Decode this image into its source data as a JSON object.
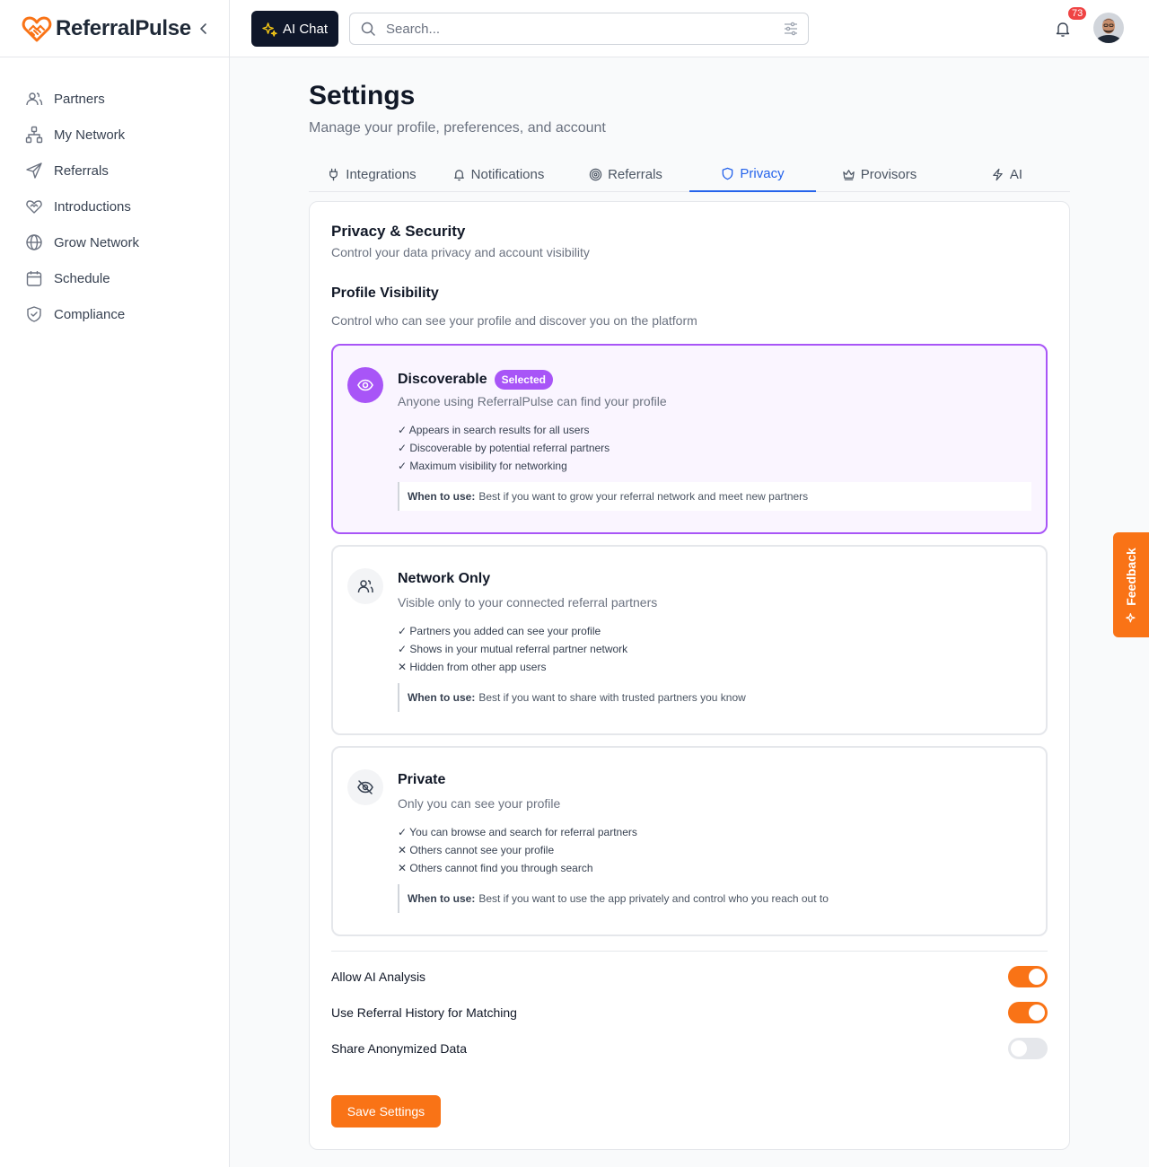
{
  "brand": {
    "name": "ReferralPulse",
    "color": "#f97316"
  },
  "sidebar": {
    "items": [
      {
        "label": "Partners",
        "icon": "users-icon"
      },
      {
        "label": "My Network",
        "icon": "network-icon"
      },
      {
        "label": "Referrals",
        "icon": "send-icon"
      },
      {
        "label": "Introductions",
        "icon": "handshake-icon"
      },
      {
        "label": "Grow Network",
        "icon": "globe-icon"
      },
      {
        "label": "Schedule",
        "icon": "calendar-icon"
      },
      {
        "label": "Compliance",
        "icon": "shield-check-icon"
      }
    ]
  },
  "header": {
    "ai_chat_label": "AI Chat",
    "search_placeholder": "Search...",
    "notification_count": "73"
  },
  "page": {
    "title": "Settings",
    "subtitle": "Manage your profile, preferences, and account"
  },
  "tabs": [
    {
      "label": "Integrations",
      "icon": "plug-icon"
    },
    {
      "label": "Notifications",
      "icon": "bell-icon"
    },
    {
      "label": "Referrals",
      "icon": "target-icon"
    },
    {
      "label": "Privacy",
      "icon": "shield-icon",
      "active": true
    },
    {
      "label": "Provisors",
      "icon": "crown-icon"
    },
    {
      "label": "AI",
      "icon": "bolt-icon"
    }
  ],
  "privacy": {
    "title": "Privacy & Security",
    "subtitle": "Control your data privacy and account visibility",
    "visibility_title": "Profile Visibility",
    "visibility_subtitle": "Control who can see your profile and discover you on the platform",
    "selected_badge": "Selected",
    "when_label": "When to use:",
    "options": [
      {
        "title": "Discoverable",
        "desc": "Anyone using ReferralPulse can find your profile",
        "points": [
          "✓ Appears in search results for all users",
          "✓ Discoverable by potential referral partners",
          "✓ Maximum visibility for networking"
        ],
        "when": "Best if you want to grow your referral network and meet new partners",
        "selected": true
      },
      {
        "title": "Network Only",
        "desc": "Visible only to your connected referral partners",
        "points": [
          "✓ Partners you added can see your profile",
          "✓ Shows in your mutual referral partner network",
          "✕ Hidden from other app users"
        ],
        "when": "Best if you want to share with trusted partners you know"
      },
      {
        "title": "Private",
        "desc": "Only you can see your profile",
        "points": [
          "✓ You can browse and search for referral partners",
          "✕ Others cannot see your profile",
          "✕ Others cannot find you through search"
        ],
        "when": "Best if you want to use the app privately and control who you reach out to"
      }
    ],
    "toggles": [
      {
        "label": "Allow AI Analysis",
        "on": true
      },
      {
        "label": "Use Referral History for Matching",
        "on": true
      },
      {
        "label": "Share Anonymized Data",
        "on": false
      }
    ],
    "save_label": "Save Settings"
  },
  "feedback_label": "Feedback",
  "colors": {
    "accent": "#f97316",
    "selected": "#a855f7",
    "tab_active": "#2563eb"
  }
}
